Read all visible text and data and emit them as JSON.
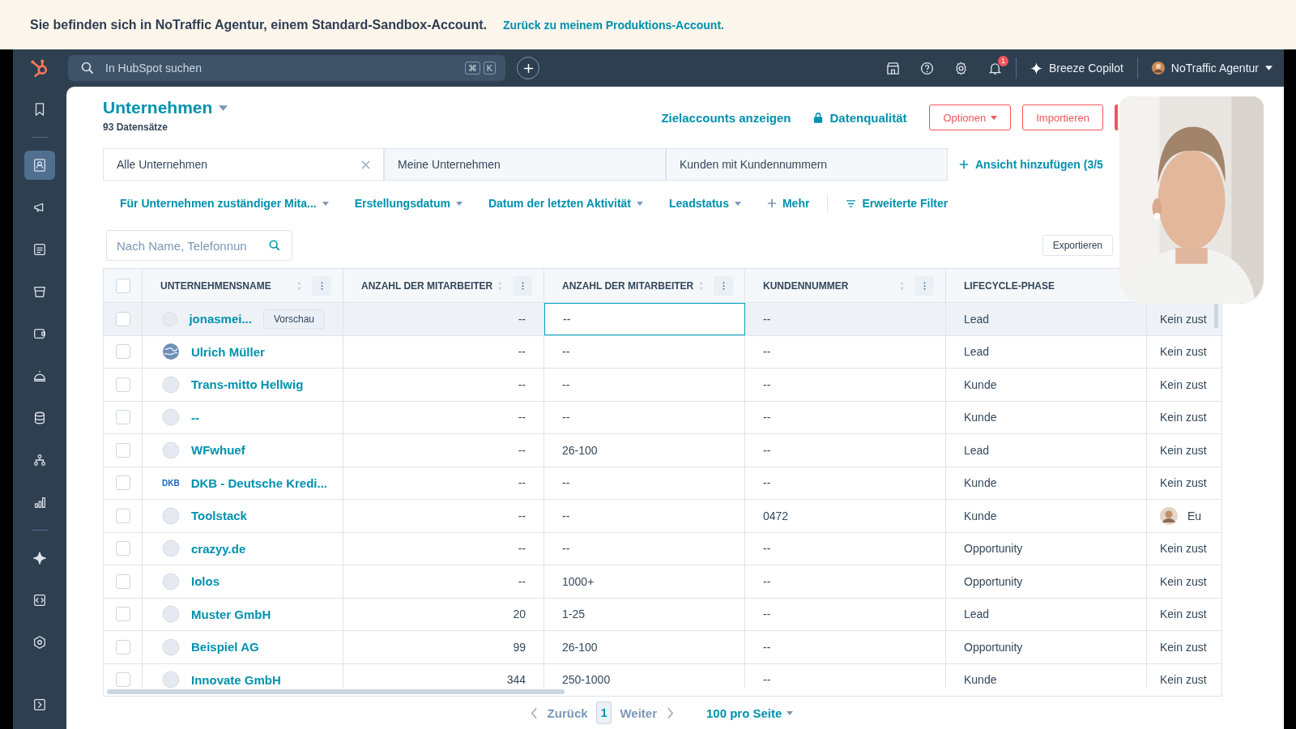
{
  "banner": {
    "text": "Sie befinden sich in NoTraffic Agentur, einem Standard-Sandbox-Account.",
    "link": "Zurück zu meinem Produktions-Account."
  },
  "nav": {
    "search_placeholder": "In HubSpot suchen",
    "shortcut_keys": [
      "⌘",
      "K"
    ],
    "notification_count": "1",
    "copilot": "Breeze Copilot",
    "account": "NoTraffic Agentur"
  },
  "sidebar": {
    "items": [
      {
        "kind": "bookmark",
        "selected": false
      },
      {
        "kind": "contacts",
        "selected": true
      },
      {
        "kind": "megaphone",
        "selected": false
      },
      {
        "kind": "document",
        "selected": false
      },
      {
        "kind": "bucket",
        "selected": false
      },
      {
        "kind": "wallet",
        "selected": false
      },
      {
        "kind": "bell",
        "selected": false
      },
      {
        "kind": "database",
        "selected": false
      },
      {
        "kind": "network",
        "selected": false
      },
      {
        "kind": "chart",
        "selected": false
      },
      {
        "kind": "sparkle",
        "selected": false
      },
      {
        "kind": "code",
        "selected": false
      },
      {
        "kind": "hexagon",
        "selected": false
      },
      {
        "kind": "expand",
        "selected": false
      }
    ]
  },
  "header": {
    "title": "Unternehmen",
    "record_count": "93 Datensätze",
    "links": [
      "Zielaccounts anzeigen",
      "Datenqualität"
    ],
    "buttons": [
      "Optionen",
      "Importieren"
    ]
  },
  "views": {
    "tabs": [
      {
        "label": "Alle Unternehmen",
        "selected": true
      },
      {
        "label": "Meine Unternehmen",
        "selected": false
      },
      {
        "label": "Kunden mit Kundennummern",
        "selected": false
      }
    ],
    "add_view": "Ansicht hinzufügen (3/5"
  },
  "filters": {
    "items": [
      {
        "label": "Für Unternehmen zuständiger Mita...",
        "kind": "dropdown"
      },
      {
        "label": "Erstellungsdatum",
        "kind": "dropdown"
      },
      {
        "label": "Datum der letzten Aktivität",
        "kind": "dropdown"
      },
      {
        "label": "Leadstatus",
        "kind": "dropdown"
      },
      {
        "label": "Mehr",
        "kind": "more"
      }
    ],
    "advanced": "Erweiterte Filter"
  },
  "table_search": {
    "placeholder": "Nach Name, Telefonnun"
  },
  "export_button": "Exportieren",
  "table": {
    "select_all_checked": false,
    "columns": [
      {
        "label": "UNTERNEHMENSNAME",
        "sortable": true,
        "menu": true
      },
      {
        "label": "ANZAHL DER MITARBEITER",
        "sortable": true,
        "menu": true
      },
      {
        "label": "ANZAHL DER MITARBEITER",
        "sortable": true,
        "menu": true
      },
      {
        "label": "KUNDENNUMMER",
        "sortable": true,
        "menu": true
      },
      {
        "label": "LIFECYCLE-PHASE",
        "sortable": false,
        "menu": false
      }
    ],
    "rows": [
      {
        "checked": false,
        "hovered": true,
        "logo": {
          "kind": "placeholder"
        },
        "name": "jonasmei...",
        "preview": "Vorschau",
        "employees": "--",
        "employees_range": "--",
        "range_focused": true,
        "customer_no": "--",
        "lifecycle": "Lead",
        "column_6": {
          "text": "Kein zust",
          "avatar": false
        }
      },
      {
        "checked": false,
        "hovered": false,
        "logo": {
          "kind": "globe"
        },
        "name": "Ulrich Müller",
        "employees": "--",
        "employees_range": "--",
        "range_focused": false,
        "customer_no": "--",
        "lifecycle": "Lead",
        "column_6": {
          "text": "Kein zust",
          "avatar": false
        }
      },
      {
        "checked": false,
        "hovered": false,
        "logo": {
          "kind": "placeholder"
        },
        "name": "Trans-mitto Hellwig",
        "employees": "--",
        "employees_range": "--",
        "range_focused": false,
        "customer_no": "--",
        "lifecycle": "Kunde",
        "column_6": {
          "text": "Kein zust",
          "avatar": false
        }
      },
      {
        "checked": false,
        "hovered": false,
        "logo": {
          "kind": "placeholder"
        },
        "name": "--",
        "employees": "--",
        "employees_range": "--",
        "range_focused": false,
        "customer_no": "--",
        "lifecycle": "Kunde",
        "column_6": {
          "text": "Kein zust",
          "avatar": false
        }
      },
      {
        "checked": false,
        "hovered": false,
        "logo": {
          "kind": "placeholder"
        },
        "name": "WFwhuef",
        "employees": "--",
        "employees_range": "26-100",
        "range_focused": false,
        "customer_no": "--",
        "lifecycle": "Lead",
        "column_6": {
          "text": "Kein zust",
          "avatar": false
        }
      },
      {
        "checked": false,
        "hovered": false,
        "logo": {
          "kind": "text",
          "text": "DKB"
        },
        "name": "DKB - Deutsche Kredi...",
        "employees": "--",
        "employees_range": "--",
        "range_focused": false,
        "customer_no": "--",
        "lifecycle": "Kunde",
        "column_6": {
          "text": "Kein zust",
          "avatar": false
        }
      },
      {
        "checked": false,
        "hovered": false,
        "logo": {
          "kind": "placeholder"
        },
        "name": "Toolstack",
        "employees": "--",
        "employees_range": "--",
        "range_focused": false,
        "customer_no": "0472",
        "lifecycle": "Kunde",
        "column_6": {
          "text": "Eu",
          "avatar": true
        }
      },
      {
        "checked": false,
        "hovered": false,
        "logo": {
          "kind": "placeholder"
        },
        "name": "crazyy.de",
        "employees": "--",
        "employees_range": "--",
        "range_focused": false,
        "customer_no": "--",
        "lifecycle": "Opportunity",
        "column_6": {
          "text": "Kein zust",
          "avatar": false
        }
      },
      {
        "checked": false,
        "hovered": false,
        "logo": {
          "kind": "placeholder"
        },
        "name": "Iolos",
        "employees": "--",
        "employees_range": "1000+",
        "range_focused": false,
        "customer_no": "--",
        "lifecycle": "Opportunity",
        "column_6": {
          "text": "Kein zust",
          "avatar": false
        }
      },
      {
        "checked": false,
        "hovered": false,
        "logo": {
          "kind": "placeholder"
        },
        "name": "Muster GmbH",
        "employees": "20",
        "employees_range": "1-25",
        "range_focused": false,
        "customer_no": "--",
        "lifecycle": "Lead",
        "column_6": {
          "text": "Kein zust",
          "avatar": false
        }
      },
      {
        "checked": false,
        "hovered": false,
        "logo": {
          "kind": "placeholder"
        },
        "name": "Beispiel AG",
        "employees": "99",
        "employees_range": "26-100",
        "range_focused": false,
        "customer_no": "--",
        "lifecycle": "Opportunity",
        "column_6": {
          "text": "Kein zust",
          "avatar": false
        }
      },
      {
        "checked": false,
        "hovered": false,
        "logo": {
          "kind": "placeholder"
        },
        "name": "Innovate GmbH",
        "employees": "344",
        "employees_range": "250-1000",
        "range_focused": false,
        "customer_no": "--",
        "lifecycle": "Kunde",
        "column_6": {
          "text": "Kein zust",
          "avatar": false
        }
      }
    ]
  },
  "pagination": {
    "previous": "Zurück",
    "page": "1",
    "next": "Weiter",
    "page_size": "100 pro Seite"
  }
}
